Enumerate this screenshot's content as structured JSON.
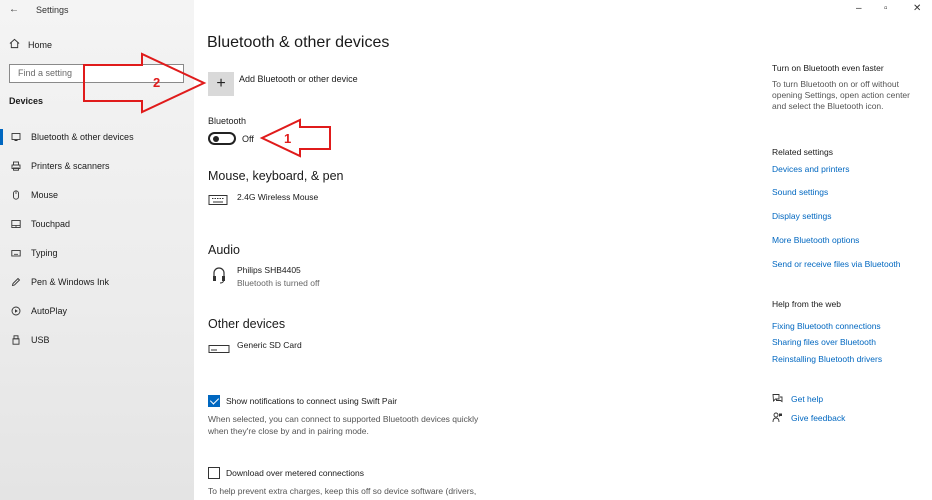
{
  "window": {
    "app_title": "Settings",
    "back_glyph": "←",
    "min_glyph": "–",
    "max_glyph": "▫",
    "close_glyph": "✕"
  },
  "sidebar": {
    "home": "Home",
    "search_placeholder": "Find a setting",
    "section": "Devices",
    "items": [
      {
        "label": "Bluetooth & other devices",
        "icon": "bluetooth-icon",
        "selected": true
      },
      {
        "label": "Printers & scanners",
        "icon": "printer-icon"
      },
      {
        "label": "Mouse",
        "icon": "mouse-icon"
      },
      {
        "label": "Touchpad",
        "icon": "touchpad-icon"
      },
      {
        "label": "Typing",
        "icon": "keyboard-icon"
      },
      {
        "label": "Pen & Windows Ink",
        "icon": "pen-icon"
      },
      {
        "label": "AutoPlay",
        "icon": "autoplay-icon"
      },
      {
        "label": "USB",
        "icon": "usb-icon"
      }
    ]
  },
  "main": {
    "title": "Bluetooth & other devices",
    "add_device": "Add Bluetooth or other device",
    "bluetooth_label": "Bluetooth",
    "bluetooth_state": "Off",
    "mouse_section": "Mouse, keyboard, & pen",
    "mouse_device": "2.4G Wireless Mouse",
    "audio_section": "Audio",
    "audio_device": "Philips SHB4405",
    "audio_status": "Bluetooth is turned off",
    "other_section": "Other devices",
    "other_device": "Generic  SD Card",
    "swift_pair_label": "Show notifications to connect using Swift Pair",
    "swift_pair_checked": true,
    "swift_pair_desc": "When selected, you can connect to supported Bluetooth devices quickly when they're close by and in pairing mode.",
    "metered_label": "Download over metered connections",
    "metered_checked": false,
    "metered_desc": "To help prevent extra charges, keep this off so device software (drivers,"
  },
  "right": {
    "faster_head": "Turn on Bluetooth even faster",
    "faster_text": "To turn Bluetooth on or off without opening Settings, open action center and select the Bluetooth icon.",
    "related_head": "Related settings",
    "related_links": [
      "Devices and printers",
      "Sound settings",
      "Display settings",
      "More Bluetooth options",
      "Send or receive files via Bluetooth"
    ],
    "help_head": "Help from the web",
    "help_links": [
      "Fixing Bluetooth connections",
      "Sharing files over Bluetooth",
      "Reinstalling Bluetooth drivers"
    ],
    "get_help": "Get help",
    "give_feedback": "Give feedback"
  },
  "annotations": {
    "arrow1": "1",
    "arrow2": "2",
    "color": "#e01b1b"
  }
}
